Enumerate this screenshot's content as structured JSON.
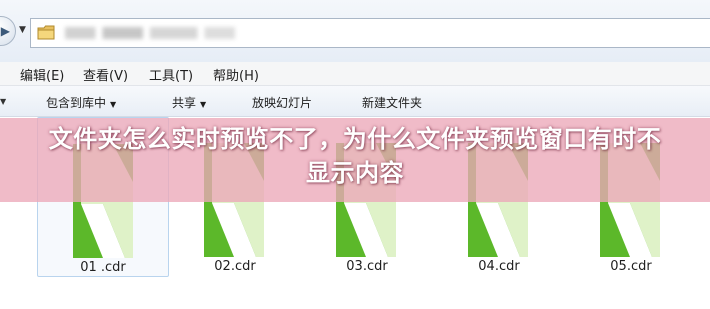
{
  "address_bar": {
    "nav_icon": "forward-arrow-icon",
    "dropdown_icon": "chevron-down-icon",
    "folder_icon": "folder-icon"
  },
  "menubar": {
    "items": [
      {
        "label": "编辑(E)"
      },
      {
        "label": "查看(V)"
      },
      {
        "label": "工具(T)"
      },
      {
        "label": "帮助(H)"
      }
    ]
  },
  "toolbar": {
    "items": [
      {
        "label": "包含到库中"
      },
      {
        "label": "共享"
      },
      {
        "label": "放映幻灯片"
      },
      {
        "label": "新建文件夹"
      }
    ]
  },
  "files": [
    {
      "name": "01 .cdr",
      "selected": true
    },
    {
      "name": "02.cdr",
      "selected": false
    },
    {
      "name": "03.cdr",
      "selected": false
    },
    {
      "name": "04.cdr",
      "selected": false
    },
    {
      "name": "05.cdr",
      "selected": false
    }
  ],
  "banner": {
    "title": "文件夹怎么实时预览不了，为什么文件夹预览窗口有时不显示内容"
  },
  "colors": {
    "thumb_green": "#5cb82a",
    "thumb_light": "#dff2c8",
    "banner_pink": "#eca8b8"
  }
}
